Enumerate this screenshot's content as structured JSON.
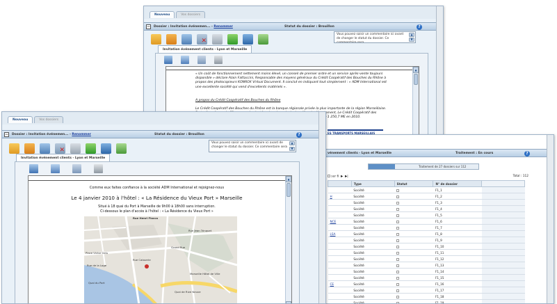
{
  "tabs": {
    "active": "Nouveau",
    "inactive": "Vos dossiers"
  },
  "titlebar": {
    "prefix": "Dossier : Invitation événemen... -",
    "link": "Renommer",
    "status": "Statut du dossier : Brouillon"
  },
  "comment": "Vous pouvez saisir un commentaire ici avant de changer le statut du dossier. Ce commentaire sera",
  "doc_tab": "Invitation événement clients - Lyon et Marseille",
  "back_doc": {
    "p1": "« Un coût de fonctionnement nettement moins élevé, un conseil de premier ordre et un service après-vente toujours disponible » déclare Alain Fattaccini, Responsable des moyens généraux du Crédit Coopératif des Bouches du Rhône à propos des photocopieurs KONROX Virtual Document. Il conclut en indiquant tout simplement : « ADM International est une excellente société qui vend d'excellents matériels ».",
    "heading": "A propos du Crédit Coopératif des Bouches du Rhône",
    "p2": "Le Crédit Coopératif des Bouches du Rhône est la banque régionale privée la plus importante de la région Marseillaise. Forte d'un réseau de 62 agences implantées dans les principales villes du département, Le Crédit Coopératif des Bouches du Rhône compte un effectif de 552 collaborateurs pour un actif géré de 1 250,7 ME en 2010.",
    "logo": "ES TRANSPORTS MARSEILLAIS"
  },
  "front_doc": {
    "intro": "Comme eux faites confiance à la société ADM International et rejoignez-nous",
    "headline": "Le 4 janvier 2010 à l'hôtel : «  La Résidence du Vieux Port  » Marseille",
    "address": "Situé à 18 quai du Port à Marseille de 9h00 à 18h00 sans interruption.",
    "map_caption": "Ci-dessous le plan d'accès à l'hôtel : « La Résidence du Vieux Port »",
    "map_labels": [
      "Rue Henri Fiocca",
      "Quai du Port",
      "Quai de Rive Neuve",
      "Rue de la Loge",
      "Place Victor Gelu",
      "Rue Caisserie",
      "Grand Rue",
      "Rue Jean Trinquet",
      "Marseille Hôtel de Ville"
    ]
  },
  "right_panel": {
    "title": "vénement clients - Lyon et Marseille",
    "status": "Traitement : En cours",
    "progress_label": "Traitement de 27 dossiers sur 112",
    "progress": 0.24,
    "total": "Total : 112",
    "pager_prefix": "sur 6",
    "columns": [
      "Type",
      "Statut",
      "N° de dossier"
    ],
    "left_labels": [
      "",
      "H",
      "",
      "",
      "",
      "NCE",
      "",
      "LSA",
      "",
      "",
      "",
      "",
      "",
      "",
      "",
      "CE",
      "",
      "",
      "",
      ""
    ],
    "rows": [
      {
        "type": "Société",
        "num": "F1_1"
      },
      {
        "type": "Société",
        "num": "F1_2"
      },
      {
        "type": "Société",
        "num": "F1_3"
      },
      {
        "type": "Société",
        "num": "F1_4"
      },
      {
        "type": "Société",
        "num": "F1_5"
      },
      {
        "type": "Société",
        "num": "F1_6"
      },
      {
        "type": "Société",
        "num": "F1_7"
      },
      {
        "type": "Société",
        "num": "F1_8"
      },
      {
        "type": "Société",
        "num": "F1_9"
      },
      {
        "type": "Société",
        "num": "F1_10"
      },
      {
        "type": "Société",
        "num": "F1_11"
      },
      {
        "type": "Société",
        "num": "F1_12"
      },
      {
        "type": "Société",
        "num": "F1_13"
      },
      {
        "type": "Société",
        "num": "F1_14"
      },
      {
        "type": "Société",
        "num": "F1_15"
      },
      {
        "type": "Société",
        "num": "F1_16"
      },
      {
        "type": "Société",
        "num": "F1_17"
      },
      {
        "type": "Société",
        "num": "F1_18"
      },
      {
        "type": "Société",
        "num": "F1_19"
      },
      {
        "type": "Société",
        "num": "F1_20"
      }
    ]
  },
  "colors": {
    "accent": "#1d4c86",
    "titlebar": "#c6d8ea",
    "link": "#1a3d9c"
  }
}
